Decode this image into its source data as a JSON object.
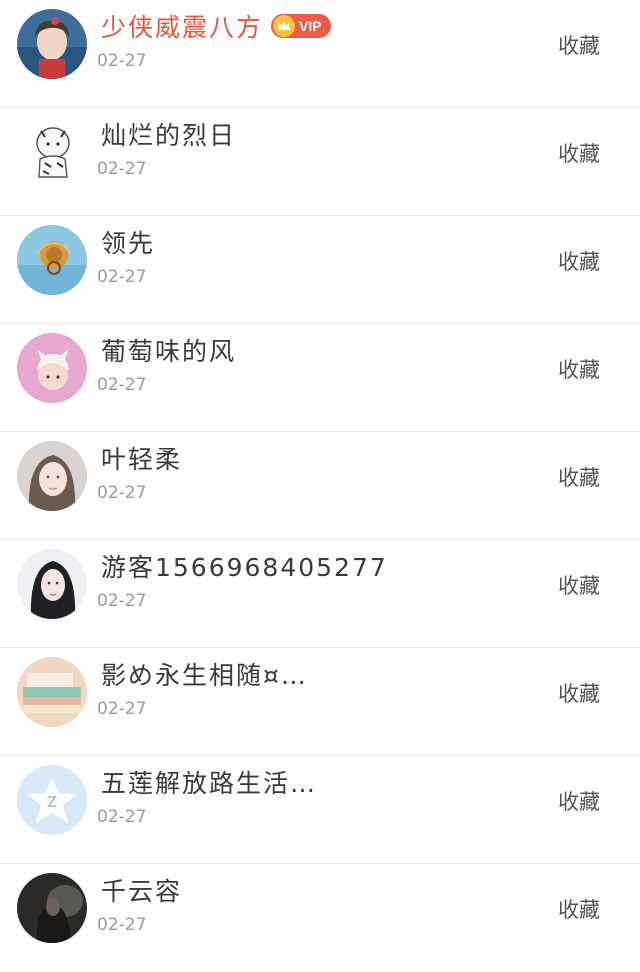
{
  "list": {
    "fav_label": "收藏",
    "vip_label": "VIP",
    "items": [
      {
        "name": "少侠威震八方",
        "date": "02-27",
        "vip": true
      },
      {
        "name": "灿烂的烈日",
        "date": "02-27"
      },
      {
        "name": "领先",
        "date": "02-27"
      },
      {
        "name": "葡萄味的风",
        "date": "02-27"
      },
      {
        "name": "叶轻柔",
        "date": "02-27"
      },
      {
        "name": "游客15669684052​77",
        "date": "02-27"
      },
      {
        "name": "影め永生相随¤…",
        "date": "02-27"
      },
      {
        "name": "五莲解放路生活…",
        "date": "02-27"
      },
      {
        "name": "千云容",
        "date": "02-27"
      }
    ]
  },
  "colors": {
    "vip_name": "#e8553c",
    "vip_badge": "#f05a48",
    "crown": "#f8c33a"
  }
}
